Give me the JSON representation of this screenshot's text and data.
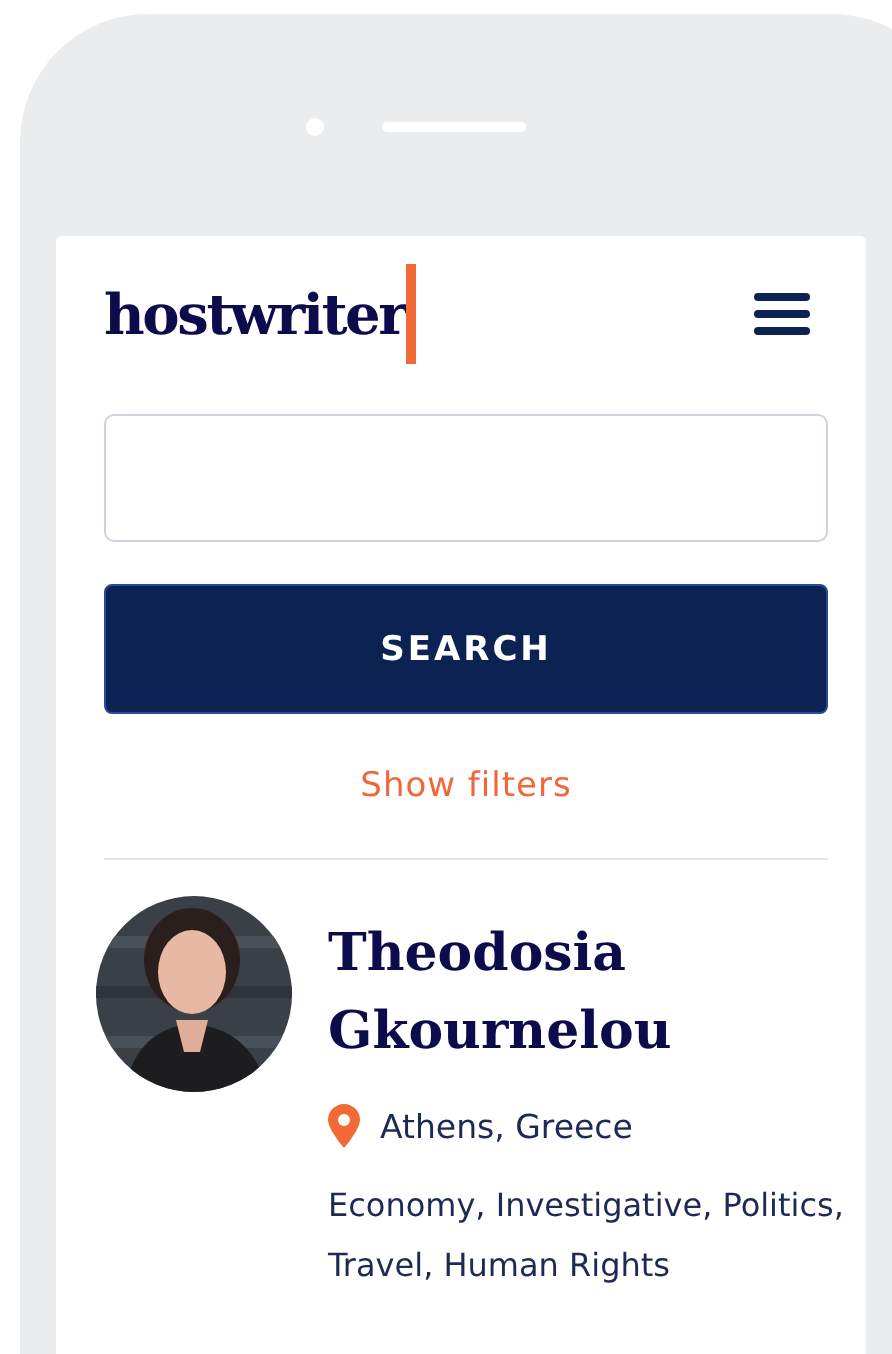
{
  "header": {
    "logo": "hostwriter"
  },
  "search": {
    "button": "SEARCH",
    "filters_link": "Show filters"
  },
  "profile": {
    "name_lines": [
      "Theodosia",
      "Gkournelou"
    ],
    "location": "Athens, Greece",
    "topics": "Economy, Investigative, Politics, Travel, Human Rights"
  }
}
